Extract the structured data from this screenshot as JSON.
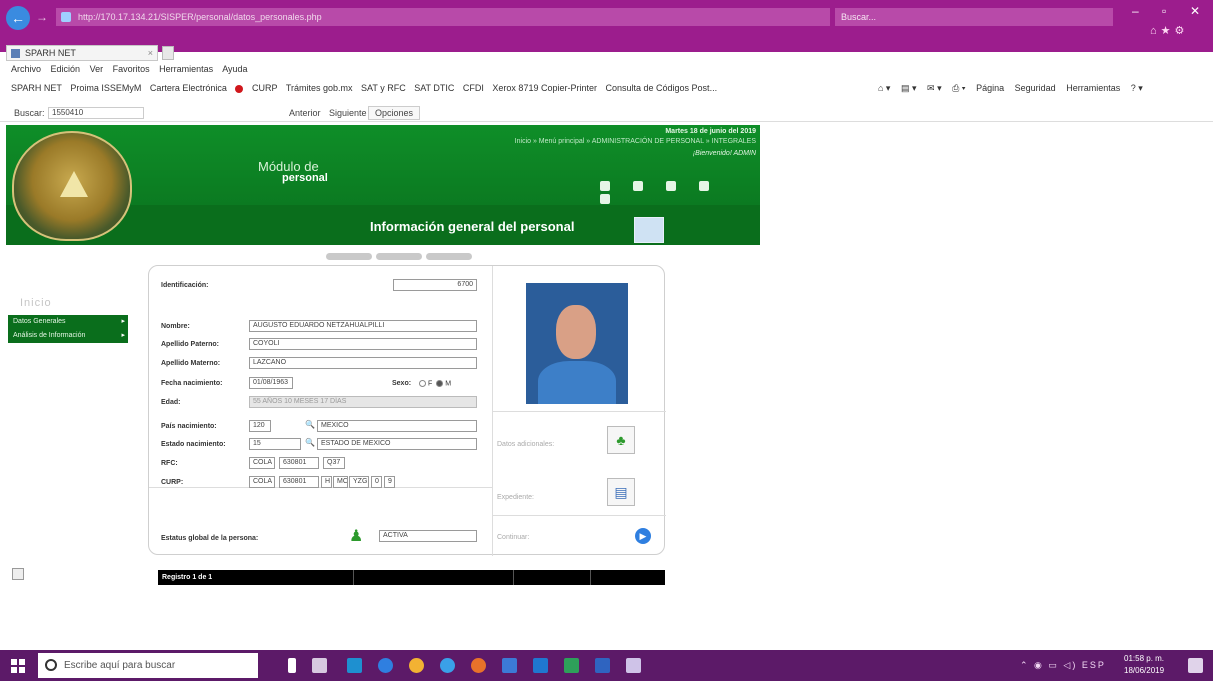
{
  "browser": {
    "address_url": "http://170.17.134.21/SISPER/personal/datos_personales.php",
    "search_placeholder": "Buscar...",
    "tab_title": "SPARH NET",
    "menu": [
      "Archivo",
      "Edición",
      "Ver",
      "Favoritos",
      "Herramientas",
      "Ayuda"
    ],
    "favorites": [
      "SPARH NET",
      "Proima ISSEMyM",
      "Cartera Electrónica",
      "CURP",
      "Trámites gob.mx",
      "SAT y RFC",
      "SAT DTIC",
      "CFDI",
      "Xerox 8719 Copier-Printer",
      "Consulta de Códigos Post..."
    ],
    "tools": [
      "Página",
      "Seguridad",
      "Herramientas"
    ],
    "find": {
      "label": "Buscar:",
      "value": "1550410",
      "prev": "Anterior",
      "next": "Siguiente",
      "options": "Opciones"
    }
  },
  "app": {
    "module_title": "Módulo de",
    "module_subtitle": "personal",
    "date": "Martes 18 de junio del 2019",
    "breadcrumb": "Inicio » Menú principal » ADMINISTRACIÓN DE PERSONAL » INTEGRALES",
    "welcome": "¡Bienvenido! ADMIN",
    "section_title": "Información general del personal",
    "left_ghost_text": "Inicio",
    "left_menu": [
      "Datos Generales",
      "Análisis de Información"
    ]
  },
  "form": {
    "id_label": "Identificación:",
    "id_value": "6700",
    "nombre_label": "Nombre:",
    "nombre_value": "AUGUSTO EDUARDO NETZAHUALPILLI",
    "ap_paterno_label": "Apellido Paterno:",
    "ap_paterno_value": "COYOLI",
    "ap_materno_label": "Apellido Materno:",
    "ap_materno_value": "LAZCANO",
    "fecha_label": "Fecha nacimiento:",
    "fecha_value": "01/08/1963",
    "sexo_label": "Sexo:",
    "sexo_f": "F",
    "sexo_m": "M",
    "edad_label": "Edad:",
    "edad_value": "55 AÑOS 10 MESES 17 DÍAS",
    "pais_label": "País nacimiento:",
    "pais_code": "120",
    "pais_value": "MEXICO",
    "estado_label": "Estado nacimiento:",
    "estado_code": "15",
    "estado_value": "ESTADO DE MEXICO",
    "rfc_label": "RFC:",
    "rfc_values": [
      "COLA",
      "630801",
      "Q37"
    ],
    "curp_label": "CURP:",
    "curp_values": [
      "COLA",
      "630801",
      "H",
      "MC",
      "YZG",
      "0",
      "9"
    ],
    "estatus_label": "Estatus global de la persona:",
    "estatus_value": "ACTIVA",
    "side_labels": [
      "Datos adicionales:",
      "Expediente:",
      "Continuar:"
    ],
    "footer_text": "Registro 1 de 1"
  },
  "taskbar": {
    "search_placeholder": "Escribe aquí para buscar",
    "time": "01:58 p. m.",
    "date": "18/06/2019",
    "lang": "ESP"
  },
  "colors": {
    "frame": "#9c1d8d",
    "header_green": "#0a7d21",
    "taskbar": "#5c1a68"
  }
}
